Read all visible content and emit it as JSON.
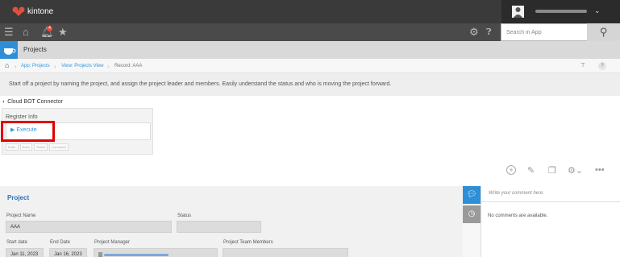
{
  "topbar": {
    "brand": "kintone",
    "user_name": "(blurred user name)"
  },
  "nav": {
    "notification_count": "4",
    "search_placeholder": "Search in App"
  },
  "app": {
    "title": "Projects"
  },
  "breadcrumb": [
    "App: Projects",
    "View: Projects View",
    "Record: AAA"
  ],
  "description": "Start off a project by naming the project, and assign the project leader and members. Easily understand the status and who is moving the project forward.",
  "connector": {
    "title": "Cloud BOT Connector",
    "panel_label": "Register Info",
    "execute_label": "Execute",
    "mini_tags": [
      "Enter",
      "Enter",
      "Select",
      "Comment"
    ],
    "highlight_color": "#e00000"
  },
  "form": {
    "section_title": "Project",
    "fields": {
      "project_name": {
        "label": "Project Name",
        "value": "AAA"
      },
      "status": {
        "label": "Status",
        "value": ""
      },
      "start_date": {
        "label": "Start date",
        "value": "Jan 11, 2023"
      },
      "end_date": {
        "label": "End Date",
        "value": "Jan 16, 2023"
      },
      "project_manager": {
        "label": "Project Manager",
        "value": "(blurred email)"
      },
      "team_members": {
        "label": "Project Team Members",
        "value": ""
      }
    }
  },
  "comments": {
    "placeholder": "Write your comment here.",
    "empty_text": "No comments are available."
  },
  "colors": {
    "accent": "#2e8fd9",
    "link": "#3498db",
    "topbar": "#3a3a3a"
  },
  "icons": [
    "menu-icon",
    "home-icon",
    "bell-icon",
    "star-icon",
    "gear-icon",
    "help-icon",
    "search-icon",
    "add-icon",
    "edit-icon",
    "copy-icon",
    "settings-icon",
    "more-icon",
    "comment-icon",
    "history-icon"
  ]
}
